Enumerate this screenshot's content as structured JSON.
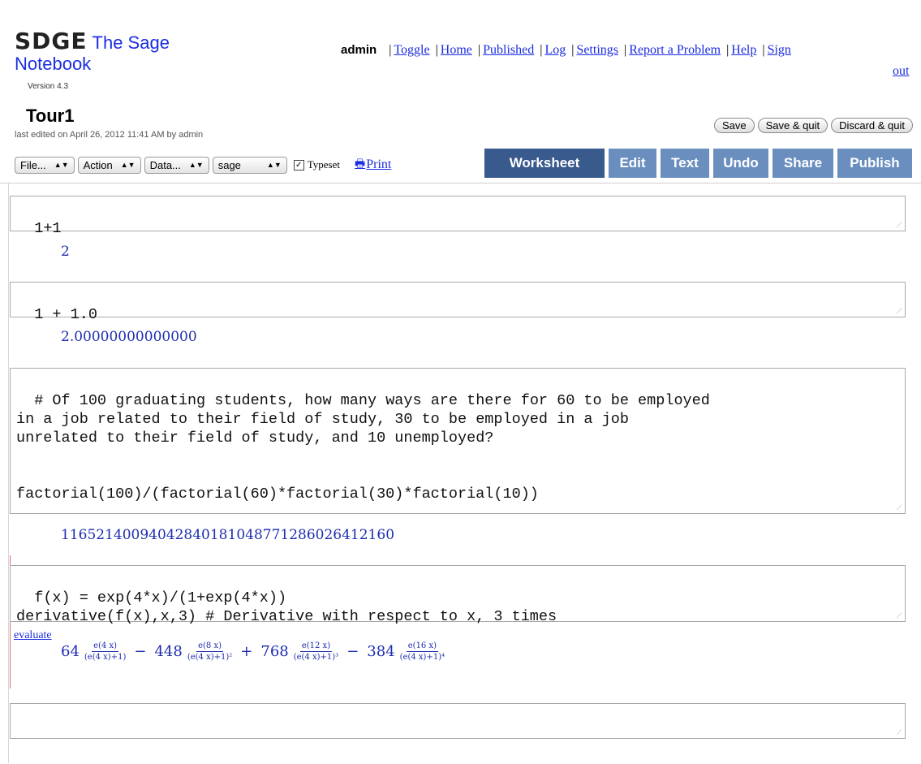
{
  "header": {
    "brand": "SDGE",
    "app_name": "The Sage",
    "app_name_line2": "Notebook",
    "version": "Version 4.3"
  },
  "topnav": {
    "user": "admin",
    "links": [
      "Toggle",
      "Home",
      "Published",
      "Log",
      "Settings",
      "Report a Problem",
      "Help",
      "Sign"
    ],
    "signout_tail": "out"
  },
  "worksheet": {
    "title": "Tour1",
    "last_edited": "last edited on April 26, 2012 11:41 AM by admin",
    "save_label": "Save",
    "save_quit_label": "Save & quit",
    "discard_quit_label": "Discard & quit"
  },
  "toolbar": {
    "file_menu": "File...",
    "action_menu": "Action",
    "data_menu": "Data...",
    "system_menu": "sage",
    "typeset_label": "Typeset",
    "typeset_checked": true,
    "print_label": "Print"
  },
  "tabs": [
    {
      "label": "Worksheet",
      "active": true
    },
    {
      "label": "Edit",
      "active": false
    },
    {
      "label": "Text",
      "active": false
    },
    {
      "label": "Undo",
      "active": false
    },
    {
      "label": "Share",
      "active": false
    },
    {
      "label": "Publish",
      "active": false
    }
  ],
  "cells": [
    {
      "input": "1+1",
      "output": "2"
    },
    {
      "input": "1 + 1.0",
      "output": "2.00000000000000"
    },
    {
      "input": "# Of 100 graduating students, how many ways are there for 60 to be employed\nin a job related to their field of study, 30 to be employed in a job\nunrelated to their field of study, and 10 unemployed?\n\n\nfactorial(100)/(factorial(60)*factorial(30)*factorial(10))",
      "output": "1165214009404284018104877128602641216​0"
    },
    {
      "input": "f(x) = exp(4*x)/(1+exp(4*x))\nderivative(f(x),x,3) # Derivative with respect to x, 3 times",
      "evaluate_label": "evaluate"
    },
    {
      "input": ""
    }
  ],
  "math_output": {
    "terms": [
      {
        "sign": "",
        "coef": "64",
        "num": "e(4 x)",
        "den": "(e(4 x)+1)"
      },
      {
        "sign": "−",
        "coef": "448",
        "num": "e(8 x)",
        "den": "(e(4 x)+1)²"
      },
      {
        "sign": "+",
        "coef": "768",
        "num": "e(12 x)",
        "den": "(e(4 x)+1)³"
      },
      {
        "sign": "−",
        "coef": "384",
        "num": "e(16 x)",
        "den": "(e(4 x)+1)⁴"
      }
    ]
  },
  "colors": {
    "link": "#1b2de0",
    "output": "#1e2db0",
    "tab": "#6a8fbf",
    "tab_active": "#385a8c"
  }
}
